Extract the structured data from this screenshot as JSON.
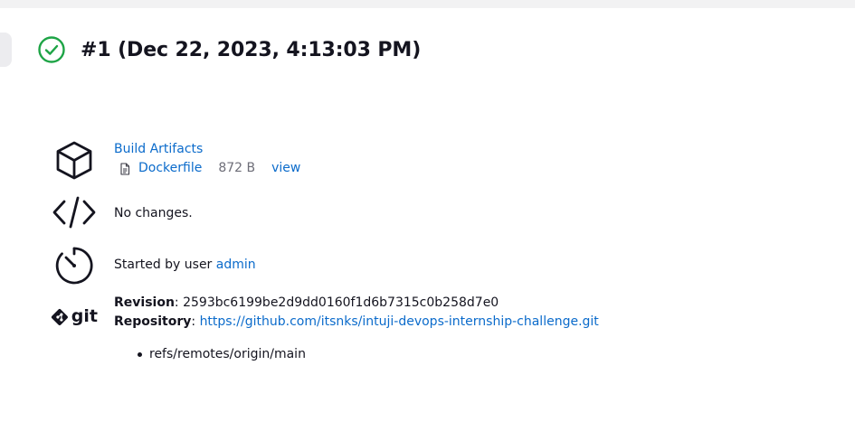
{
  "header": {
    "title": "#1 (Dec 22, 2023, 4:13:03 PM)",
    "status": "success",
    "status_color": "#1ea446"
  },
  "artifacts": {
    "heading": "Build Artifacts",
    "files": [
      {
        "name": "Dockerfile",
        "size": "872 B",
        "action": "view"
      }
    ]
  },
  "changes": {
    "text": "No changes."
  },
  "cause": {
    "prefix": "Started by user ",
    "user": "admin"
  },
  "git": {
    "icon_label": "git",
    "revision_label": "Revision",
    "revision_value": "2593bc6199be2d9dd0160f1d6b7315c0b258d7e0",
    "repository_label": "Repository",
    "repository_url": "https://github.com/itsnks/intuji-devops-internship-challenge.git",
    "branches": [
      "refs/remotes/origin/main"
    ]
  },
  "colors": {
    "link": "#0b6bcb",
    "text": "#14141f",
    "muted": "#6e6e78"
  }
}
